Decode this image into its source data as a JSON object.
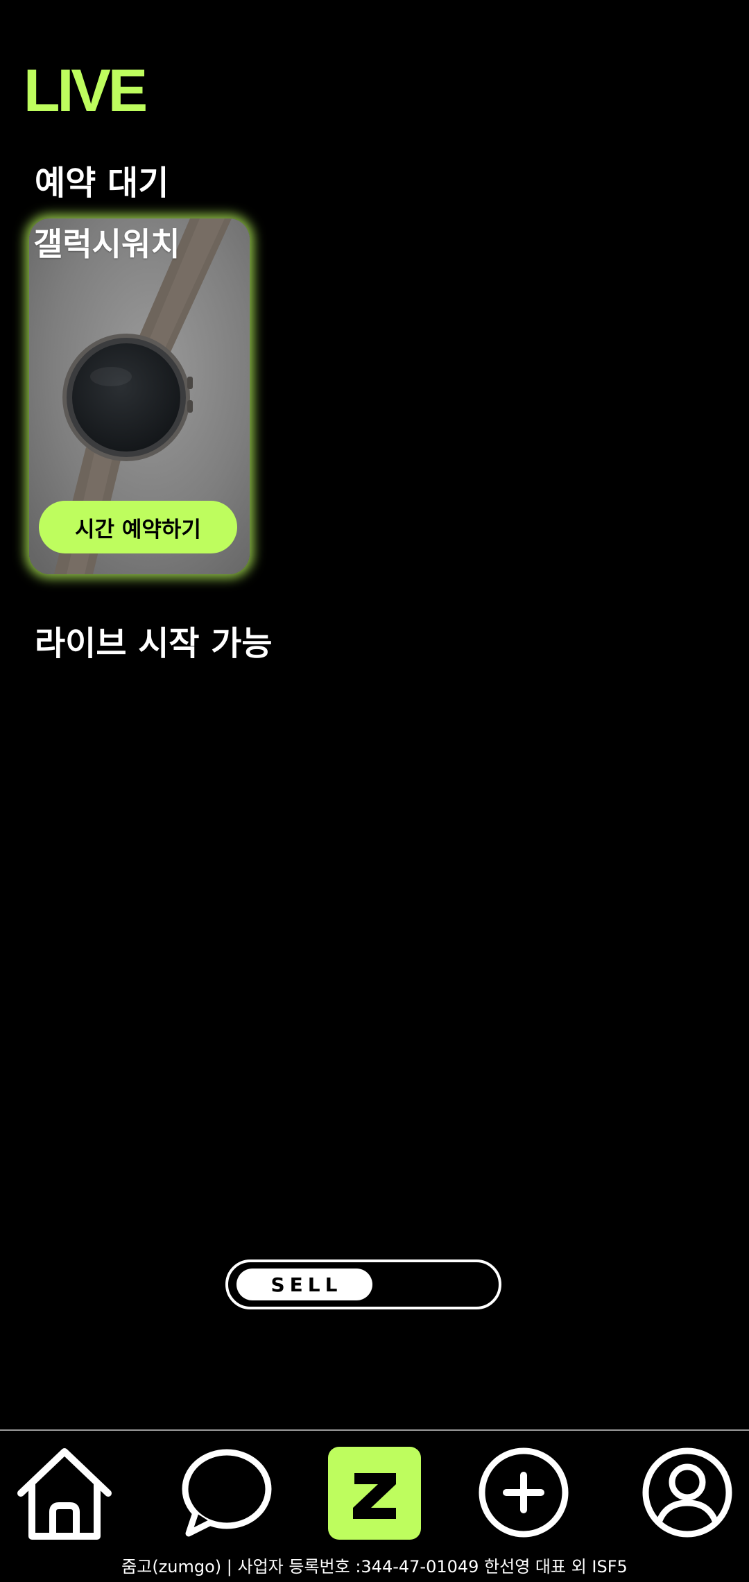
{
  "app": {
    "logo_text": "LIVE"
  },
  "colors": {
    "accent": "#befd5e",
    "background": "#000000",
    "text": "#ffffff"
  },
  "sections": {
    "reserved_title": "예약 대기",
    "live_ready_title": "라이브 시작 가능"
  },
  "reserved_items": [
    {
      "title": "갤럭시워치",
      "image_icon": "smartwatch-photo",
      "action_label": "시간 예약하기"
    }
  ],
  "mode_toggle": {
    "label": "SELL"
  },
  "bottom_nav": {
    "items": [
      {
        "icon": "home-icon"
      },
      {
        "icon": "chat-bubble-icon"
      },
      {
        "icon": "z-logo-icon",
        "label": "Z"
      },
      {
        "icon": "plus-circle-icon"
      },
      {
        "icon": "user-profile-icon"
      }
    ]
  },
  "footer": {
    "text": "줌고(zumgo) | 사업자 등록번호 :344-47-01049 한선영 대표 외 ISF5"
  }
}
